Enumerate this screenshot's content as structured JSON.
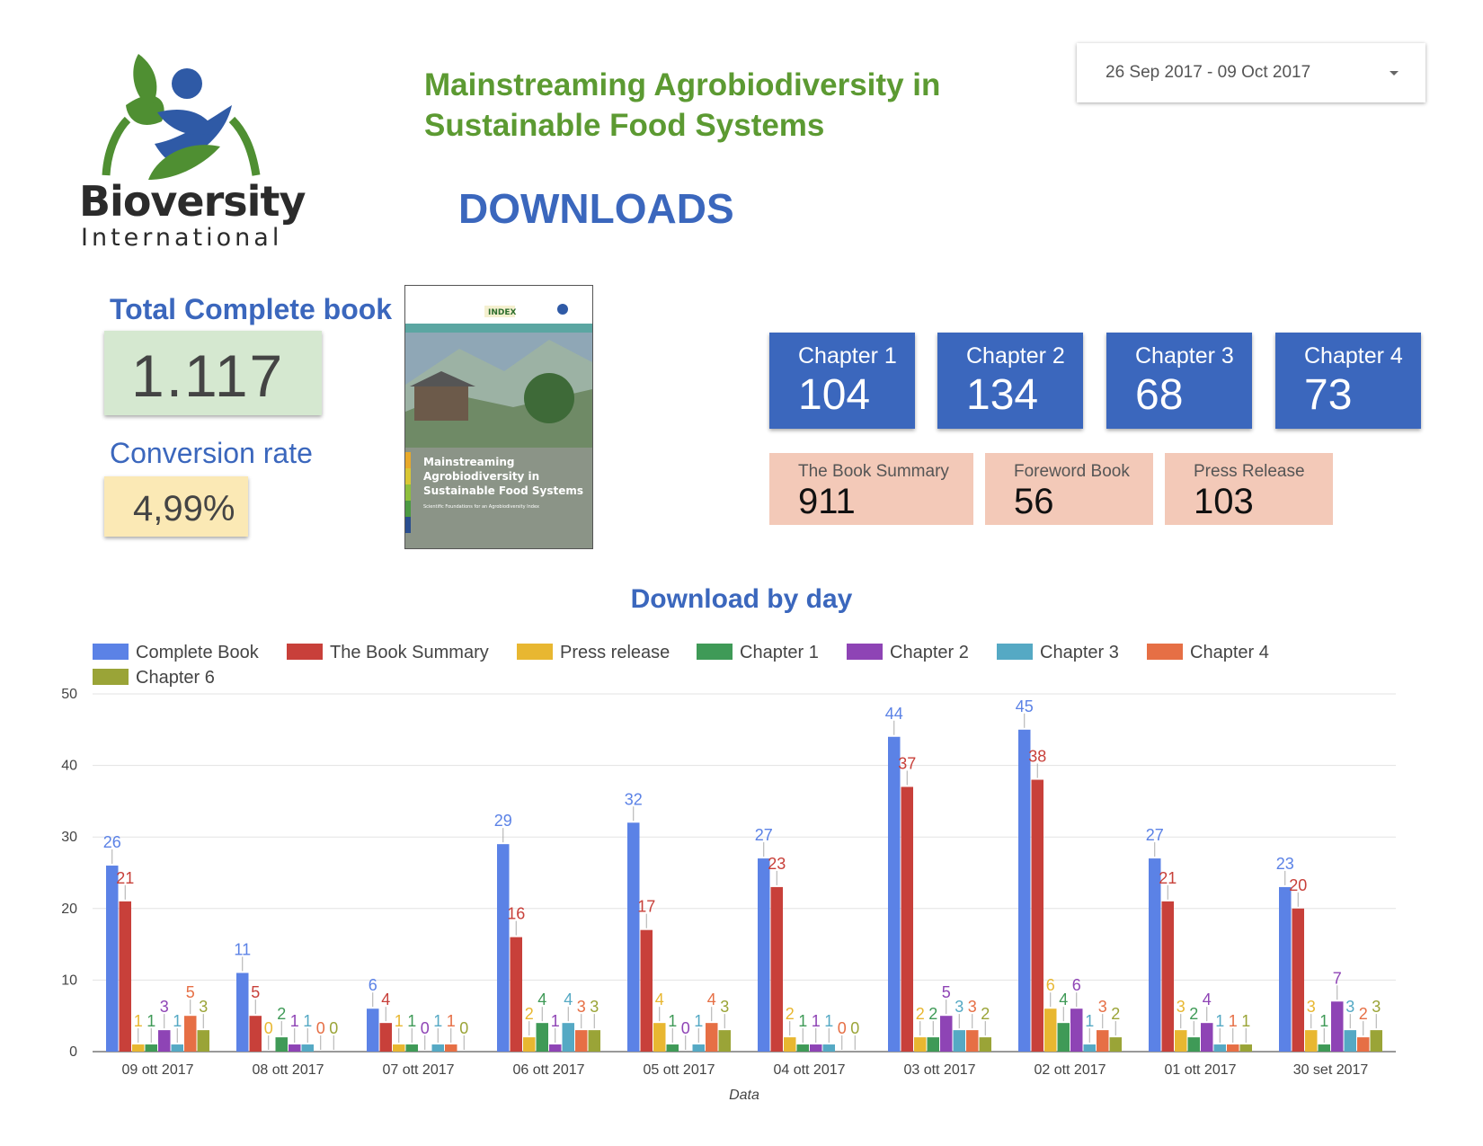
{
  "logo": {
    "word": "Bioversity",
    "sub": "International"
  },
  "header": {
    "title": "Mainstreaming Agrobiodiversity in Sustainable Food Systems",
    "heading": "DOWNLOADS"
  },
  "date_range": {
    "value": "26 Sep 2017 - 09 Oct 2017"
  },
  "kpis": {
    "total_label": "Total Complete book",
    "total_value": "1.117",
    "conversion_label": "Conversion rate",
    "conversion_value": "4,99%"
  },
  "cover": {
    "top_logo": "INDEX",
    "title_lines": [
      "Mainstreaming",
      "Agrobiodiversity in",
      "Sustainable Food Systems"
    ],
    "subtitle": "Scientific Foundations for an Agrobiodiversity Index"
  },
  "chapters": [
    {
      "label": "Chapter 1",
      "value": "104"
    },
    {
      "label": "Chapter 2",
      "value": "134"
    },
    {
      "label": "Chapter 3",
      "value": "68"
    },
    {
      "label": "Chapter 4",
      "value": "73"
    }
  ],
  "extras": [
    {
      "label": "The Book Summary",
      "value": "911"
    },
    {
      "label": "Foreword Book",
      "value": "56"
    },
    {
      "label": "Press Release",
      "value": "103"
    }
  ],
  "chart_data": {
    "type": "bar",
    "title": "Download by day",
    "xlabel": "Data",
    "ylabel": "",
    "ylim": [
      0,
      50
    ],
    "yticks": [
      0,
      10,
      20,
      30,
      40,
      50
    ],
    "grid": true,
    "legend_position": "top-left",
    "categories": [
      "09 ott 2017",
      "08 ott 2017",
      "07 ott 2017",
      "06 ott 2017",
      "05 ott 2017",
      "04 ott 2017",
      "03 ott 2017",
      "02 ott 2017",
      "01 ott 2017",
      "30 set 2017"
    ],
    "series": [
      {
        "name": "Complete Book",
        "color": "#5b82e6",
        "values": [
          26,
          11,
          6,
          29,
          32,
          27,
          44,
          45,
          27,
          23
        ]
      },
      {
        "name": "The Book Summary",
        "color": "#c8403a",
        "values": [
          21,
          5,
          4,
          16,
          17,
          23,
          37,
          38,
          21,
          20
        ]
      },
      {
        "name": "Press release",
        "color": "#e8b731",
        "values": [
          1,
          0,
          1,
          2,
          4,
          2,
          2,
          6,
          3,
          3
        ]
      },
      {
        "name": "Chapter 1",
        "color": "#3f9a57",
        "values": [
          1,
          2,
          1,
          4,
          1,
          1,
          2,
          4,
          2,
          1
        ]
      },
      {
        "name": "Chapter 2",
        "color": "#8e44b5",
        "values": [
          3,
          1,
          0,
          1,
          0,
          1,
          5,
          6,
          4,
          7
        ]
      },
      {
        "name": "Chapter 3",
        "color": "#55a9c4",
        "values": [
          1,
          1,
          1,
          4,
          1,
          1,
          3,
          1,
          1,
          3
        ]
      },
      {
        "name": "Chapter 4",
        "color": "#e66f45",
        "values": [
          5,
          0,
          1,
          3,
          4,
          0,
          3,
          3,
          1,
          2
        ]
      },
      {
        "name": "Chapter 6",
        "color": "#9aa437",
        "values": [
          3,
          0,
          0,
          3,
          3,
          0,
          2,
          2,
          1,
          3
        ]
      }
    ]
  }
}
